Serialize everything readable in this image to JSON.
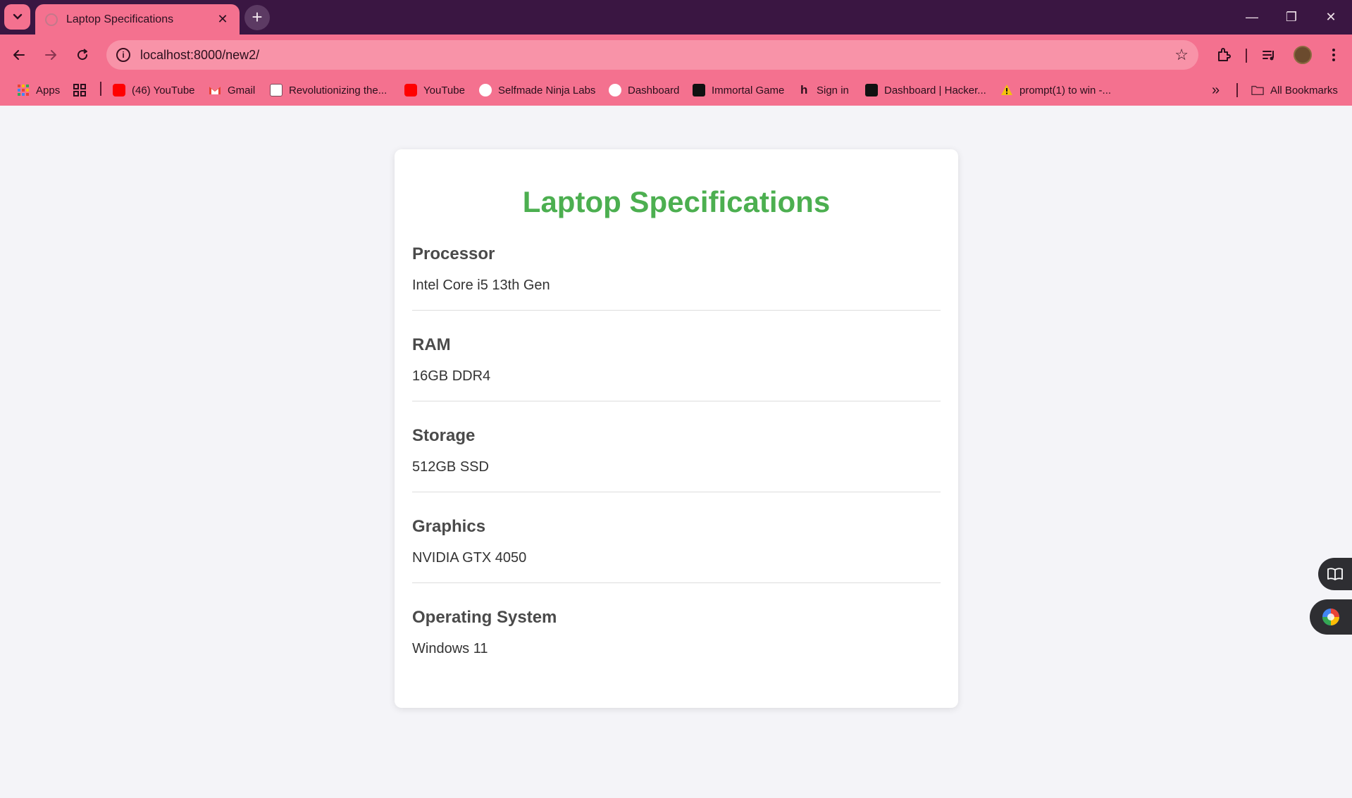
{
  "browser": {
    "tab_title": "Laptop Specifications",
    "url": "localhost:8000/new2/",
    "window_controls": {
      "minimize": "—",
      "restore": "❐",
      "close": "✕"
    },
    "bookmarks": [
      {
        "label": "Apps",
        "icon": "apps-grid-icon",
        "color": "#e94235"
      },
      {
        "label": "(46) YouTube",
        "icon": "youtube-icon",
        "color": "#ff0000"
      },
      {
        "label": "Gmail",
        "icon": "gmail-icon",
        "color": "#ea4335"
      },
      {
        "label": "Revolutionizing the...",
        "icon": "news-icon",
        "color": "#ffffff"
      },
      {
        "label": "YouTube",
        "icon": "youtube-icon",
        "color": "#ff0000"
      },
      {
        "label": "Selfmade Ninja Labs",
        "icon": "ninja-icon",
        "color": "#ffffff"
      },
      {
        "label": "Dashboard",
        "icon": "dashboard-icon",
        "color": "#ffffff"
      },
      {
        "label": "Immortal Game",
        "icon": "chess-icon",
        "color": "#111111"
      },
      {
        "label": "Sign in",
        "icon": "hashnode-h-icon",
        "color": "#222222"
      },
      {
        "label": "Dashboard | Hacker...",
        "icon": "hackerrank-icon",
        "color": "#111111"
      },
      {
        "label": "prompt(1) to win -...",
        "icon": "warning-icon",
        "color": "#f4c20d"
      }
    ],
    "all_bookmarks": "All Bookmarks",
    "more_bookmarks": "»"
  },
  "page": {
    "title": "Laptop Specifications",
    "specs": [
      {
        "label": "Processor",
        "value": "Intel Core i5 13th Gen"
      },
      {
        "label": "RAM",
        "value": "16GB DDR4"
      },
      {
        "label": "Storage",
        "value": "512GB SSD"
      },
      {
        "label": "Graphics",
        "value": "NVIDIA GTX 4050"
      },
      {
        "label": "Operating System",
        "value": "Windows 11"
      }
    ]
  },
  "colors": {
    "accent_title": "#4caf50",
    "chrome_tabbar": "#3a1642",
    "chrome_toolbar": "#f4718f",
    "page_background": "#f4f4f8"
  }
}
